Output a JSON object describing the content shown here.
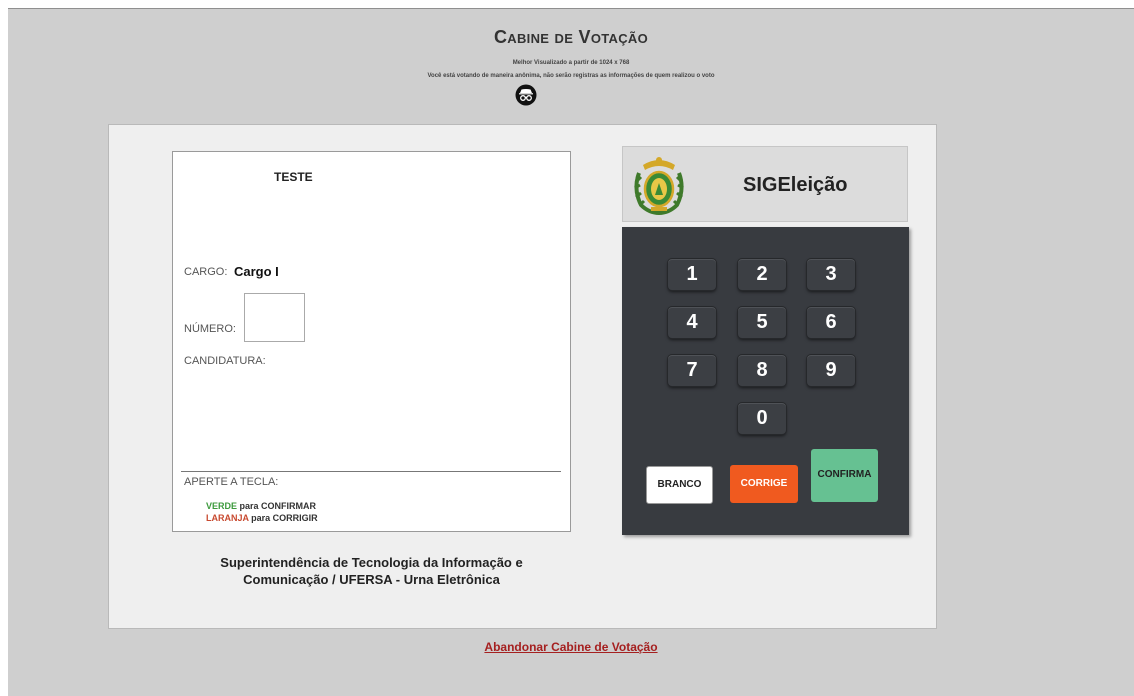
{
  "header": {
    "title": "Cabine de Votação",
    "best_view": "Melhor Visualizado a partir de 1024 x 768",
    "anonymous_notice": "Você está votando de maneira anônima, não serão registras as informações de quem realizou o voto",
    "incognito_icon": "incognito-icon"
  },
  "ballot": {
    "election_name": "TESTE",
    "cargo_label": "CARGO:",
    "cargo_value": "Cargo I",
    "numero_label": "NÚMERO:",
    "numero_value": "",
    "candidatura_label": "CANDIDATURA:",
    "aperte_label": "APERTE A TECLA:",
    "hint_green_word": "VERDE",
    "hint_green_rest": " para CONFIRMAR",
    "hint_orange_word": "LARANJA",
    "hint_orange_rest": " para CORRIGIR"
  },
  "footer": {
    "line1": "Superintendência de Tecnologia da Informação e",
    "line2": "Comunicação / UFERSA - Urna Eletrônica"
  },
  "brand": {
    "name": "SIGEleição",
    "emblem_icon": "coat-of-arms-icon"
  },
  "keypad": {
    "keys": [
      "1",
      "2",
      "3",
      "4",
      "5",
      "6",
      "7",
      "8",
      "9",
      "0"
    ],
    "branco_label": "BRANCO",
    "corrige_label": "CORRIGE",
    "confirma_label": "CONFIRMA",
    "colors": {
      "keypad_bg": "#383b40",
      "branco": "#ffffff",
      "corrige": "#f05a1f",
      "confirma": "#66c192"
    }
  },
  "abandon_link": "Abandonar Cabine de Votação"
}
